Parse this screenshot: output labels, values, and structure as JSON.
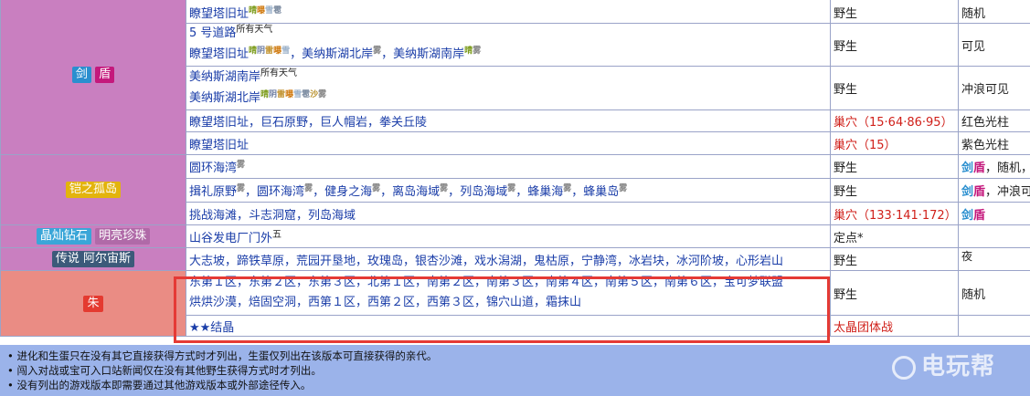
{
  "games": {
    "sword_shield": {
      "sword": "剑",
      "shield": "盾"
    },
    "crown": "铠之孤岛",
    "bdsp": {
      "bd": "晶灿钻石",
      "sp": "明亮珍珠"
    },
    "legends": "传说 阿尔宙斯",
    "scarlet": "朱"
  },
  "colors": {
    "sword": "#2a8fcf",
    "shield": "#c4187c",
    "crown": "#e3b40c",
    "bd": "#3aa6d8",
    "sp": "#b06aa8",
    "legends": "#3c5a7a",
    "scarlet": "#e43a30",
    "highlight": "#e53a35",
    "footer": "#9bb3ea"
  },
  "rows": {
    "r1": {
      "loc": "瞭望塔旧址",
      "w1": "晴",
      "w2": "曝",
      "w3": "雪",
      "w4": "雹",
      "how": "野生",
      "note": "随机"
    },
    "r2": {
      "l1": "5 号道路",
      "l1sup": "所有天气",
      "l2a": "瞭望塔旧址",
      "l2w": [
        "晴",
        "阴",
        "雷",
        "曝",
        "雪"
      ],
      "l2b": "美纳斯湖北岸",
      "l2bw": "雾",
      "l2c": "美纳斯湖南岸",
      "l2cw": [
        "晴",
        "雾"
      ],
      "sep": "，",
      "how": "野生",
      "note": "可见"
    },
    "r3": {
      "l1": "美纳斯湖南岸",
      "l1sup": "所有天气",
      "l2": "美纳斯湖北岸",
      "l2w": [
        "晴",
        "阴",
        "雷",
        "曝",
        "雪",
        "雹",
        "沙",
        "雾"
      ],
      "how": "野生",
      "note": "冲浪可见"
    },
    "r4": {
      "loc": "瞭望塔旧址，巨石原野，巨人帽岩，拳关丘陵",
      "how": "巢穴（15·64·86·95）",
      "note": "红色光柱"
    },
    "r5": {
      "loc": "瞭望塔旧址",
      "how": "巢穴（15）",
      "note": "紫色光柱"
    },
    "r6": {
      "loc": "圆环海湾",
      "w": "雾",
      "how": "野生",
      "note_a": "剑",
      "note_b": "盾",
      "note_c": "，随机，"
    },
    "r7": {
      "a": "揖礼原野",
      "b": "圆环海湾",
      "c": "健身之海",
      "d": "离岛海域",
      "e": "列岛海域",
      "f": "蜂巢海",
      "g": "蜂巢岛",
      "w": "雾",
      "sep": "，",
      "how": "野生",
      "note_a": "剑",
      "note_b": "盾",
      "note_c": "，冲浪可"
    },
    "r8": {
      "loc": "挑战海滩，斗志洞窟，列岛海域",
      "how": "巢穴（133·141·172）",
      "note_a": "剑",
      "note_b": "盾"
    },
    "r9": {
      "loc": "山谷发电厂门外",
      "sup": "五",
      "how": "定点*",
      "note": ""
    },
    "r10": {
      "loc": "大志坡，蹄铁草原，荒园开垦地，玫瑰岛，银杏沙滩，戏水潟湖，鬼枯原，宁静湾，冰岩块，冰河阶坡，心形岩山",
      "how": "野生",
      "note": "夜"
    },
    "r11": {
      "l1": "东第１区，东第２区，东第３区，北第１区，南第２区，南第３区，南第４区，南第５区，南第６区，宝可梦联盟",
      "l2": "烘烘沙漠，焙固空洞，西第１区，西第２区，西第３区，锦穴山道，霜抹山",
      "how": "野生",
      "note": "随机"
    },
    "r12": {
      "loc": "★★结晶",
      "how": "太晶团体战",
      "note": ""
    }
  },
  "footer": [
    "• 进化和生蛋只在没有其它直接获得方式时才列出，生蛋仅列出在该版本可直接获得的亲代。",
    "• 闯入对战或宝可入口站新闻仅在没有其他野生获得方式时才列出。",
    "• 没有列出的游戏版本即需要通过其他游戏版本或外部途径传入。"
  ],
  "watermark": "电玩帮"
}
